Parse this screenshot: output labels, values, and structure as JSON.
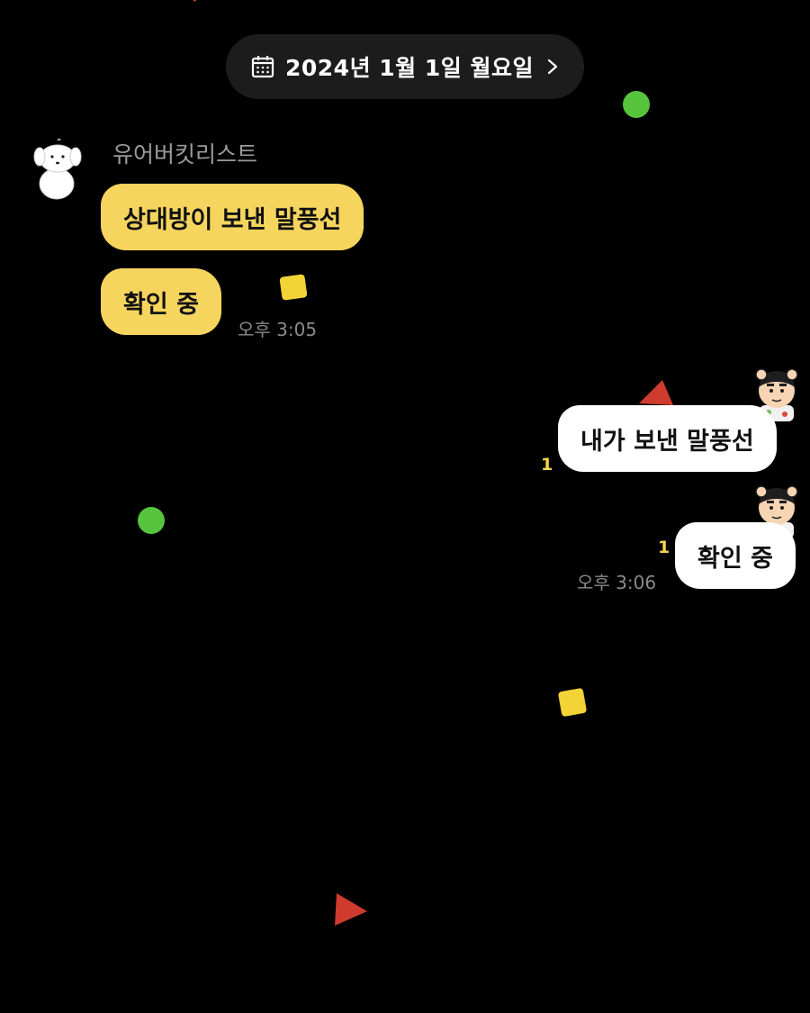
{
  "header": {
    "date_label": "2024년 1월 1일 월요일",
    "calendar_icon": "calendar-icon",
    "chevron_icon": "chevron-right-icon"
  },
  "chat": {
    "sender_name": "유어버킷리스트",
    "incoming": [
      {
        "text": "상대방이 보낸 말풍선"
      },
      {
        "text": "확인 중"
      }
    ],
    "incoming_time": "오후 3:05",
    "outgoing": [
      {
        "text": "내가 보낸 말풍선",
        "unread": "1"
      },
      {
        "text": "확인 중",
        "unread": "1"
      }
    ],
    "outgoing_time": "오후 3:06"
  },
  "colors": {
    "background": "#000000",
    "incoming_bubble": "#f6d55e",
    "outgoing_bubble": "#ffffff",
    "unread_count": "#f4d451",
    "date_pill": "#1c1c1c"
  },
  "icons": {
    "avatar_other": "white-puppy-avatar",
    "avatar_me": "cartoon-boy-avatar",
    "confetti": [
      "green-dot",
      "yellow-square",
      "red-triangle"
    ]
  }
}
